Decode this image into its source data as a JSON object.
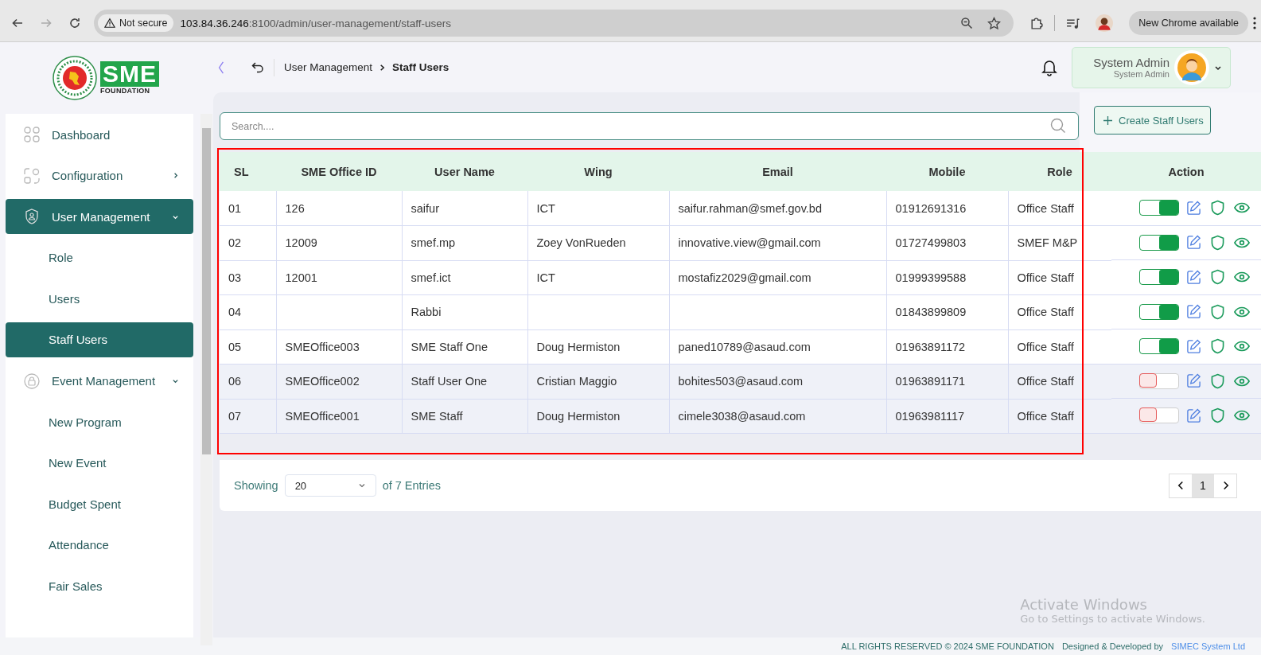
{
  "browser": {
    "security": "Not secure",
    "url_host": "103.84.36.246",
    "url_rest": ":8100/admin/user-management/staff-users",
    "update_button": "New Chrome available"
  },
  "logo": {
    "brand": "SME",
    "tagline": "FOUNDATION"
  },
  "header": {
    "breadcrumb": [
      {
        "label": "User Management",
        "current": false
      },
      {
        "label": "Staff Users",
        "current": true
      }
    ],
    "user_name": "System Admin",
    "user_role": "System Admin"
  },
  "sidebar": {
    "items": [
      {
        "label": "Dashboard",
        "kind": "parent",
        "selected": false
      },
      {
        "label": "Configuration",
        "kind": "parent",
        "selected": false,
        "expanded": false
      },
      {
        "label": "User Management",
        "kind": "parent",
        "selected": true,
        "expanded": true
      },
      {
        "label": "Role",
        "kind": "child",
        "selected": false
      },
      {
        "label": "Users",
        "kind": "child",
        "selected": false
      },
      {
        "label": "Staff Users",
        "kind": "child",
        "selected": true
      },
      {
        "label": "Event Management",
        "kind": "parent",
        "selected": false,
        "expanded": true
      },
      {
        "label": "New Program",
        "kind": "child",
        "selected": false
      },
      {
        "label": "New Event",
        "kind": "child",
        "selected": false
      },
      {
        "label": "Budget Spent",
        "kind": "child",
        "selected": false
      },
      {
        "label": "Attendance",
        "kind": "child",
        "selected": false
      },
      {
        "label": "Fair Sales",
        "kind": "child",
        "selected": false
      }
    ]
  },
  "search": {
    "placeholder": "Search...."
  },
  "create_button": "Create Staff Users",
  "table": {
    "columns": [
      "SL",
      "SME Office ID",
      "User Name",
      "Wing",
      "Email",
      "Mobile",
      "Role",
      "Action"
    ],
    "rows": [
      {
        "sl": "01",
        "office_id": "126",
        "user_name": "saifur",
        "wing": "ICT",
        "email": "saifur.rahman@smef.gov.bd",
        "mobile": "01912691316",
        "role": "Office Staff",
        "active": true
      },
      {
        "sl": "02",
        "office_id": "12009",
        "user_name": "smef.mp",
        "wing": "Zoey VonRueden",
        "email": "innovative.view@gmail.com",
        "mobile": "01727499803",
        "role": "SMEF M&P",
        "active": true
      },
      {
        "sl": "03",
        "office_id": "12001",
        "user_name": "smef.ict",
        "wing": "ICT",
        "email": "mostafiz2029@gmail.com",
        "mobile": "01999399588",
        "role": "Office Staff",
        "active": true
      },
      {
        "sl": "04",
        "user_name": "Rabbi",
        "mobile": "01843899809",
        "role": "Office Staff",
        "active": true
      },
      {
        "sl": "05",
        "office_id": "SMEOffice003",
        "user_name": "SME Staff One",
        "wing": "Doug Hermiston",
        "email": "paned10789@asaud.com",
        "mobile": "01963891172",
        "role": "Office Staff",
        "active": true
      },
      {
        "sl": "06",
        "office_id": "SMEOffice002",
        "user_name": "Staff User One",
        "wing": "Cristian Maggio",
        "email": "bohites503@asaud.com",
        "mobile": "01963891171",
        "role": "Office Staff",
        "active": false
      },
      {
        "sl": "07",
        "office_id": "SMEOffice001",
        "user_name": "SME Staff",
        "wing": "Doug Hermiston",
        "email": "cimele3038@asaud.com",
        "mobile": "01963981117",
        "role": "Office Staff",
        "active": false
      }
    ]
  },
  "pagination": {
    "showing": "Showing",
    "per_page": "20",
    "entries": "of 7 Entries",
    "pages": [
      {
        "label": "1",
        "selected": true
      }
    ]
  },
  "footer": {
    "copyright": "ALL RIGHTS RESERVED © 2024 SME FOUNDATION",
    "designed_by": "Designed & Developed by",
    "developer": "SIMEC System Ltd"
  },
  "os_notice": {
    "title": "Activate Windows",
    "subtitle": "Go to Settings to activate Windows."
  }
}
